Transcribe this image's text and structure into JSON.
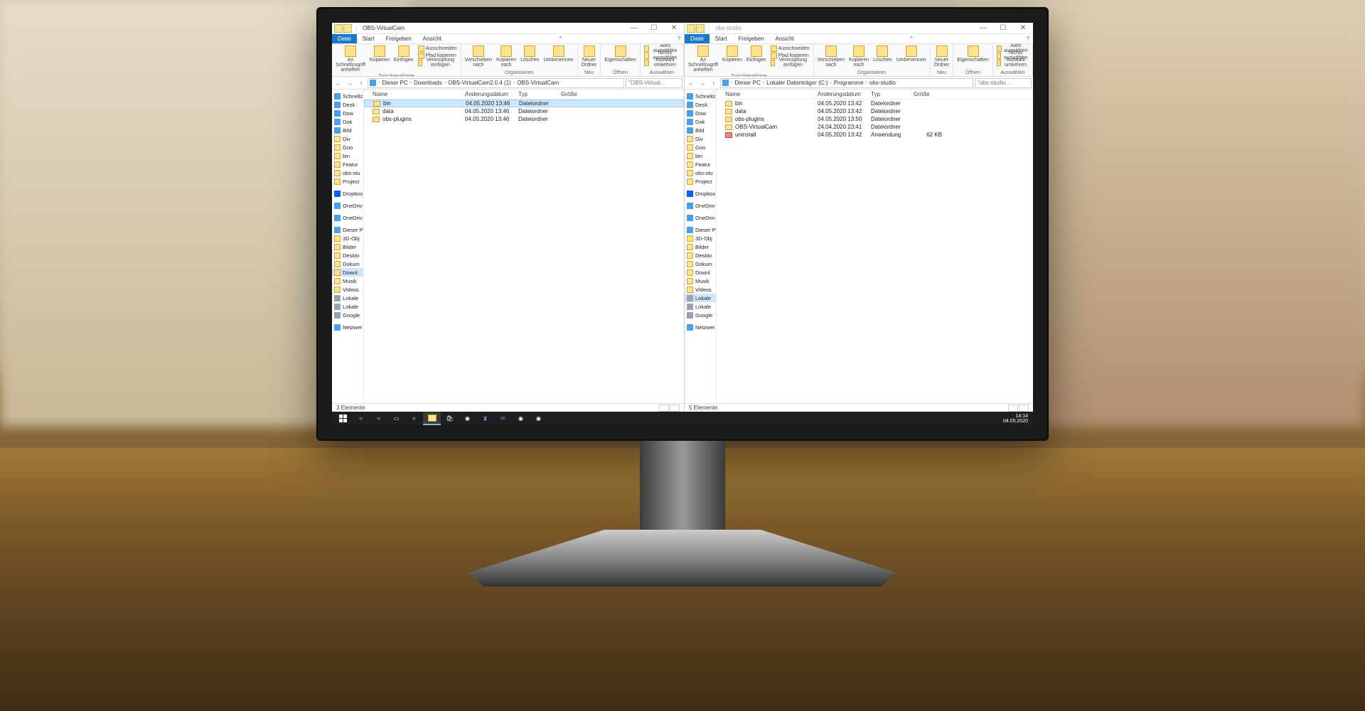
{
  "taskbar": {
    "time": "14:14",
    "date": "04.05.2020"
  },
  "left_window": {
    "title": "OBS-VirtualCam",
    "tabs": [
      "Datei",
      "Start",
      "Freigeben",
      "Ansicht"
    ],
    "ribbon": {
      "groups": [
        {
          "label": "Zwischenablage",
          "big": [
            {
              "text": "An Schnellzugriff\nanheften"
            },
            {
              "text": "Kopieren"
            },
            {
              "text": "Einfügen"
            }
          ],
          "small": [
            "Ausschneiden",
            "Pfad kopieren",
            "Verknüpfung einfügen"
          ]
        },
        {
          "label": "Organisieren",
          "items": [
            "Verschieben nach",
            "Kopieren nach",
            "Löschen",
            "Umbenennen"
          ]
        },
        {
          "label": "Neu",
          "items": [
            "Neuer\nOrdner"
          ]
        },
        {
          "label": "Öffnen",
          "items": [
            "Eigenschaften"
          ]
        },
        {
          "label": "Auswählen",
          "small": [
            "Alles auswählen",
            "Nichts auswählen",
            "Auswahl umkehren"
          ]
        }
      ]
    },
    "breadcrumbs": [
      "Dieser PC",
      "Downloads",
      "OBS-VirtualCam2.0.4 (1)",
      "OBS-VirtualCam"
    ],
    "search_placeholder": "\"OBS-Virtual...",
    "columns": {
      "name": "Name",
      "date": "Änderungsdatum",
      "type": "Typ",
      "size": "Größe"
    },
    "files": [
      {
        "name": "bin",
        "date": "04.05.2020 13:46",
        "type": "Dateiordner",
        "selected": true
      },
      {
        "name": "data",
        "date": "04.05.2020 13:46",
        "type": "Dateiordner"
      },
      {
        "name": "obs-plugins",
        "date": "04.05.2020 13:46",
        "type": "Dateiordner"
      }
    ],
    "status": "3 Elemente"
  },
  "right_window": {
    "title": "obs-studio",
    "tabs": [
      "Datei",
      "Start",
      "Freigeben",
      "Ansicht"
    ],
    "breadcrumbs": [
      "Dieser PC",
      "Lokaler Datenträger (C:)",
      "Programme",
      "obs-studio"
    ],
    "search_placeholder": "\"obs-studio...",
    "columns": {
      "name": "Name",
      "date": "Änderungsdatum",
      "type": "Typ",
      "size": "Größe"
    },
    "files": [
      {
        "name": "bin",
        "date": "04.05.2020 13:42",
        "type": "Dateiordner"
      },
      {
        "name": "data",
        "date": "04.05.2020 13:42",
        "type": "Dateiordner"
      },
      {
        "name": "obs-plugins",
        "date": "04.05.2020 13:50",
        "type": "Dateiordner"
      },
      {
        "name": "OBS-VirtualCam",
        "date": "24.04.2020 23:41",
        "type": "Dateiordner"
      },
      {
        "name": "uninstall",
        "date": "04.05.2020 13:42",
        "type": "Anwendung",
        "size": "62 KB",
        "icon": "app"
      }
    ],
    "status": "5 Elemente"
  },
  "nav": {
    "items": [
      {
        "l": "Schnellz",
        "i": "star"
      },
      {
        "l": "Desk",
        "i": "blue",
        "pin": true
      },
      {
        "l": "Dow",
        "i": "blue",
        "pin": true
      },
      {
        "l": "Dok",
        "i": "blue",
        "pin": true
      },
      {
        "l": "Bild",
        "i": "blue",
        "pin": true
      },
      {
        "l": "Div",
        "i": "folder"
      },
      {
        "l": "Goo",
        "i": "folder"
      },
      {
        "l": "bin",
        "i": "folder"
      },
      {
        "l": "Featur",
        "i": "folder"
      },
      {
        "l": "obs-stu",
        "i": "folder"
      },
      {
        "l": "Project",
        "i": "folder"
      },
      {
        "l": "",
        "i": ""
      },
      {
        "l": "Dropbox",
        "i": "dropbox"
      },
      {
        "l": "",
        "i": ""
      },
      {
        "l": "OneDriv",
        "i": "blue"
      },
      {
        "l": "",
        "i": ""
      },
      {
        "l": "OneDriv",
        "i": "blue"
      },
      {
        "l": "",
        "i": ""
      },
      {
        "l": "Dieser P",
        "i": "blue"
      },
      {
        "l": "3D-Obj",
        "i": "folder"
      },
      {
        "l": "Bilder",
        "i": "folder"
      },
      {
        "l": "Deskto",
        "i": "folder"
      },
      {
        "l": "Dokum",
        "i": "folder"
      },
      {
        "l": "Downl",
        "i": "folder",
        "sel_left": true
      },
      {
        "l": "Musik",
        "i": "folder"
      },
      {
        "l": "Videos",
        "i": "folder"
      },
      {
        "l": "Lokale",
        "i": "drive",
        "sel_right": true
      },
      {
        "l": "Lokale",
        "i": "drive"
      },
      {
        "l": "Google",
        "i": "drive"
      },
      {
        "l": "",
        "i": ""
      },
      {
        "l": "Netzwer",
        "i": "blue"
      }
    ]
  }
}
